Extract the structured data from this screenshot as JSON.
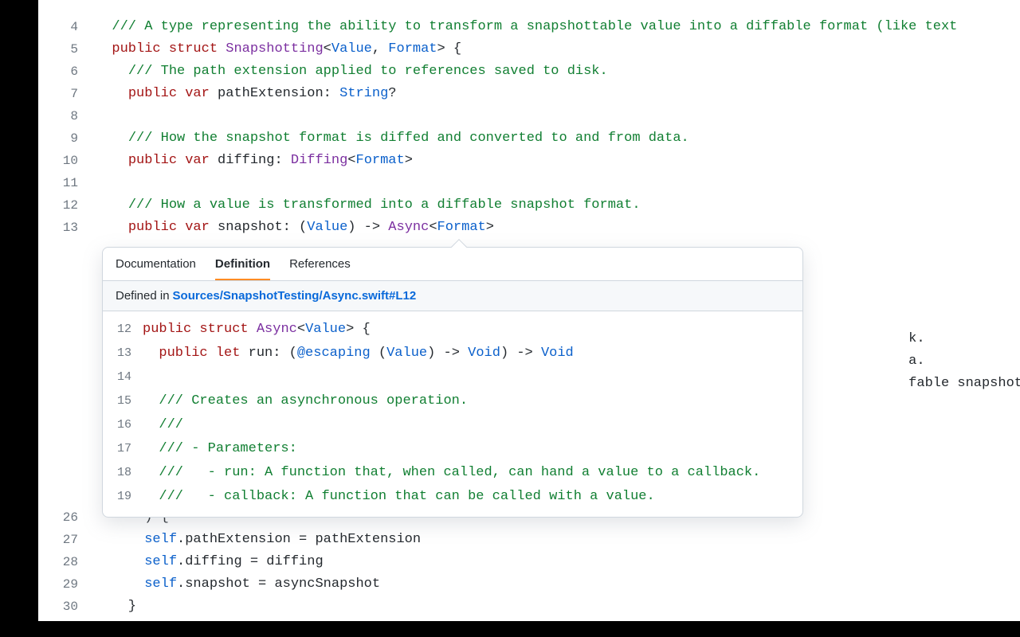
{
  "main": {
    "lines": [
      {
        "n": "4",
        "tokens": [
          [
            "  ",
            "id"
          ],
          [
            "/// A type representing the ability to transform a snapshottable value into a diffable format (like text",
            "doc"
          ]
        ]
      },
      {
        "n": "5",
        "tokens": [
          [
            "  ",
            "id"
          ],
          [
            "public",
            "kw"
          ],
          [
            " ",
            "id"
          ],
          [
            "struct",
            "kw"
          ],
          [
            " ",
            "id"
          ],
          [
            "Snapshotting",
            "type"
          ],
          [
            "<",
            "id"
          ],
          [
            "Value",
            "gen"
          ],
          [
            ", ",
            "id"
          ],
          [
            "Format",
            "gen"
          ],
          [
            "> {",
            "id"
          ]
        ]
      },
      {
        "n": "6",
        "tokens": [
          [
            "    ",
            "id"
          ],
          [
            "/// The path extension applied to references saved to disk.",
            "doc"
          ]
        ]
      },
      {
        "n": "7",
        "tokens": [
          [
            "    ",
            "id"
          ],
          [
            "public",
            "kw"
          ],
          [
            " ",
            "id"
          ],
          [
            "var",
            "kw"
          ],
          [
            " pathExtension: ",
            "id"
          ],
          [
            "String",
            "gen"
          ],
          [
            "?",
            "id"
          ]
        ]
      },
      {
        "n": "8",
        "tokens": [
          [
            "",
            "id"
          ]
        ]
      },
      {
        "n": "9",
        "tokens": [
          [
            "    ",
            "id"
          ],
          [
            "/// How the snapshot format is diffed and converted to and from data.",
            "doc"
          ]
        ]
      },
      {
        "n": "10",
        "tokens": [
          [
            "    ",
            "id"
          ],
          [
            "public",
            "kw"
          ],
          [
            " ",
            "id"
          ],
          [
            "var",
            "kw"
          ],
          [
            " diffing: ",
            "id"
          ],
          [
            "Diffing",
            "type"
          ],
          [
            "<",
            "id"
          ],
          [
            "Format",
            "gen"
          ],
          [
            ">",
            "id"
          ]
        ]
      },
      {
        "n": "11",
        "tokens": [
          [
            "",
            "id"
          ]
        ]
      },
      {
        "n": "12",
        "tokens": [
          [
            "    ",
            "id"
          ],
          [
            "/// How a value is transformed into a diffable snapshot format.",
            "doc"
          ]
        ]
      },
      {
        "n": "13",
        "tokens": [
          [
            "    ",
            "id"
          ],
          [
            "public",
            "kw"
          ],
          [
            " ",
            "id"
          ],
          [
            "var",
            "kw"
          ],
          [
            " snapshot: (",
            "id"
          ],
          [
            "Value",
            "gen"
          ],
          [
            ") -> ",
            "id"
          ],
          [
            "Async",
            "type"
          ],
          [
            "<",
            "id"
          ],
          [
            "Format",
            "gen"
          ],
          [
            ">",
            "id"
          ]
        ]
      }
    ],
    "bg_lines": [
      {
        "n": "",
        "tokens": [
          [
            "                                                                                                    k.",
            "id"
          ]
        ]
      },
      {
        "n": "",
        "tokens": [
          [
            "                                                                                                    a.",
            "id"
          ]
        ]
      },
      {
        "n": "",
        "tokens": [
          [
            "                                                                                                    fable snapshot format.",
            "id"
          ]
        ]
      }
    ],
    "lines_after": [
      {
        "n": "26",
        "tokens": [
          [
            "      ) {",
            "id"
          ]
        ]
      },
      {
        "n": "27",
        "tokens": [
          [
            "      ",
            "id"
          ],
          [
            "self",
            "gen"
          ],
          [
            ".pathExtension = pathExtension",
            "id"
          ]
        ]
      },
      {
        "n": "28",
        "tokens": [
          [
            "      ",
            "id"
          ],
          [
            "self",
            "gen"
          ],
          [
            ".diffing = diffing",
            "id"
          ]
        ]
      },
      {
        "n": "29",
        "tokens": [
          [
            "      ",
            "id"
          ],
          [
            "self",
            "gen"
          ],
          [
            ".snapshot = asyncSnapshot",
            "id"
          ]
        ]
      },
      {
        "n": "30",
        "tokens": [
          [
            "    }",
            "id"
          ]
        ]
      }
    ]
  },
  "popover": {
    "tabs": [
      "Documentation",
      "Definition",
      "References"
    ],
    "active_tab": "Definition",
    "defined_in_label": "Defined in",
    "defined_in_link": "Sources/SnapshotTesting/Async.swift#L12",
    "lines": [
      {
        "n": "12",
        "tokens": [
          [
            "public",
            "kw"
          ],
          [
            " ",
            "id"
          ],
          [
            "struct",
            "kw"
          ],
          [
            " ",
            "id"
          ],
          [
            "Async",
            "type"
          ],
          [
            "<",
            "id"
          ],
          [
            "Value",
            "gen"
          ],
          [
            "> {",
            "id"
          ]
        ]
      },
      {
        "n": "13",
        "tokens": [
          [
            "  ",
            "id"
          ],
          [
            "public",
            "kw"
          ],
          [
            " ",
            "id"
          ],
          [
            "let",
            "kw"
          ],
          [
            " run: (",
            "id"
          ],
          [
            "@escaping",
            "gen"
          ],
          [
            " (",
            "id"
          ],
          [
            "Value",
            "gen"
          ],
          [
            ") -> ",
            "id"
          ],
          [
            "Void",
            "gen"
          ],
          [
            ") -> ",
            "id"
          ],
          [
            "Void",
            "gen"
          ]
        ]
      },
      {
        "n": "14",
        "tokens": [
          [
            "",
            "id"
          ]
        ]
      },
      {
        "n": "15",
        "tokens": [
          [
            "  ",
            "id"
          ],
          [
            "/// Creates an asynchronous operation.",
            "doc"
          ]
        ]
      },
      {
        "n": "16",
        "tokens": [
          [
            "  ",
            "id"
          ],
          [
            "///",
            "doc"
          ]
        ]
      },
      {
        "n": "17",
        "tokens": [
          [
            "  ",
            "id"
          ],
          [
            "/// - Parameters:",
            "doc"
          ]
        ]
      },
      {
        "n": "18",
        "tokens": [
          [
            "  ",
            "id"
          ],
          [
            "///   - run: A function that, when called, can hand a value to a callback.",
            "doc"
          ]
        ]
      },
      {
        "n": "19",
        "tokens": [
          [
            "  ",
            "id"
          ],
          [
            "///   - callback: A function that can be called with a value.",
            "doc"
          ]
        ]
      }
    ]
  }
}
